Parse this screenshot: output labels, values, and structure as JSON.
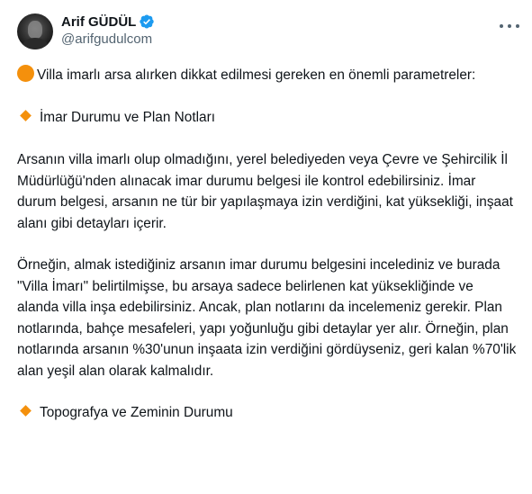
{
  "author": {
    "name": "Arif GÜDÜL",
    "handle": "@arifgudulcom"
  },
  "icons": {
    "avatar": "profile-photo",
    "verified": "verified-badge-icon",
    "more": "more-options-icon",
    "bullet_circle": "orange-circle-emoji",
    "bullet_diamond": "orange-diamond-emoji"
  },
  "colors": {
    "verified_blue": "#1d9bf0",
    "emoji_orange": "#f4900c",
    "text": "#0f1419",
    "secondary_text": "#536471"
  },
  "tweet": {
    "intro": "Villa imarlı arsa alırken dikkat edilmesi gereken en önemli parametreler:",
    "heading1": "İmar Durumu ve Plan Notları",
    "para1": "Arsanın villa imarlı olup olmadığını, yerel belediyeden veya Çevre ve Şehircilik İl Müdürlüğü'nden alınacak imar durumu belgesi ile kontrol edebilirsiniz. İmar durum belgesi, arsanın ne tür bir yapılaşmaya izin verdiğini, kat yüksekliği, inşaat alanı gibi detayları içerir.",
    "para2": "Örneğin, almak istediğiniz arsanın imar durumu belgesini incelediniz ve burada \"Villa İmarı\" belirtilmişse, bu arsaya sadece belirlenen kat yüksekliğinde ve alanda villa inşa edebilirsiniz. Ancak, plan notlarını da incelemeniz gerekir. Plan notlarında, bahçe mesafeleri, yapı yoğunluğu gibi detaylar yer alır. Örneğin, plan notlarında arsanın %30'unun inşaata izin verdiğini gördüyseniz, geri kalan %70'lik alan yeşil alan olarak kalmalıdır.",
    "heading2": "Topografya ve Zeminin Durumu"
  }
}
